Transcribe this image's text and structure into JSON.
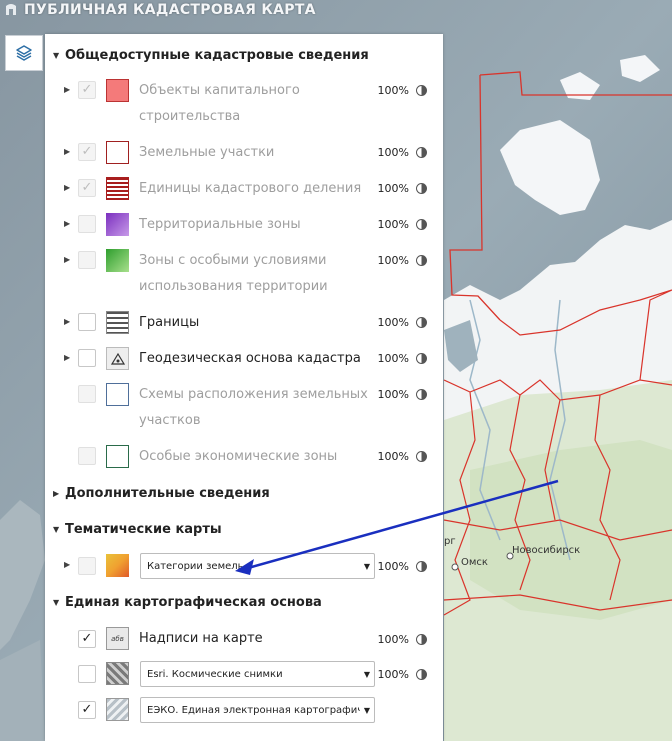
{
  "app": {
    "title": "ПУБЛИЧНАЯ КАДАСТРОВАЯ КАРТА"
  },
  "colors": {
    "accent": "#2c6ea5",
    "annotation_arrow": "#1a2fbf",
    "region_border": "#d9342b"
  },
  "sections": {
    "public": {
      "title": "Общедоступные кадастровые сведения",
      "expanded": true,
      "layers": [
        {
          "line1": "Объекты капитального",
          "line2": "строительства",
          "opacity": "100%",
          "checked": true,
          "disabled": true,
          "icon": "capital-objects-icon"
        },
        {
          "line1": "Земельные участки",
          "opacity": "100%",
          "checked": true,
          "disabled": true,
          "icon": "land-plots-icon"
        },
        {
          "line1": "Единицы кадастрового деления",
          "opacity": "100%",
          "checked": true,
          "disabled": true,
          "icon": "cadastral-division-icon"
        },
        {
          "line1": "Территориальные зоны",
          "opacity": "100%",
          "checked": false,
          "disabled": true,
          "icon": "territorial-zones-icon"
        },
        {
          "line1": "Зоны с особыми условиями",
          "line2": "использования территории",
          "opacity": "100%",
          "checked": false,
          "disabled": true,
          "icon": "special-zones-icon"
        },
        {
          "line1": "Границы",
          "opacity": "100%",
          "checked": false,
          "disabled": false,
          "icon": "borders-icon"
        },
        {
          "line1": "Геодезическая основа кадастра",
          "opacity": "100%",
          "checked": false,
          "disabled": false,
          "icon": "geodetic-icon"
        },
        {
          "line1": "Схемы расположения земельных",
          "line2": "участков",
          "opacity": "100%",
          "checked": false,
          "disabled": true,
          "icon": "layout-schemes-icon"
        },
        {
          "line1": "Особые экономические зоны",
          "opacity": "100%",
          "checked": false,
          "disabled": true,
          "icon": "economic-zones-icon"
        }
      ]
    },
    "additional": {
      "title": "Дополнительные сведения",
      "expanded": false
    },
    "thematic": {
      "title": "Тематические карты",
      "expanded": true,
      "layer": {
        "select_value": "Категории земель",
        "opacity": "100%",
        "checked": false,
        "icon": "land-categories-icon"
      }
    },
    "base": {
      "title": "Единая картографическая основа",
      "expanded": true,
      "layers": [
        {
          "label": "Надписи на карте",
          "opacity": "100%",
          "checked": true,
          "icon": "map-labels-icon"
        },
        {
          "select_value": "Esri. Космические снимки",
          "opacity": "100%",
          "checked": false,
          "icon": "satellite-icon"
        },
        {
          "select_value": "ЕЭКО. Единая электронная картографическая основа",
          "checked": true,
          "icon": "eeko-icon"
        }
      ]
    }
  },
  "map": {
    "cities": [
      {
        "name": "Омск"
      },
      {
        "name": "Новосибирск"
      },
      {
        "name": "рг"
      }
    ]
  }
}
